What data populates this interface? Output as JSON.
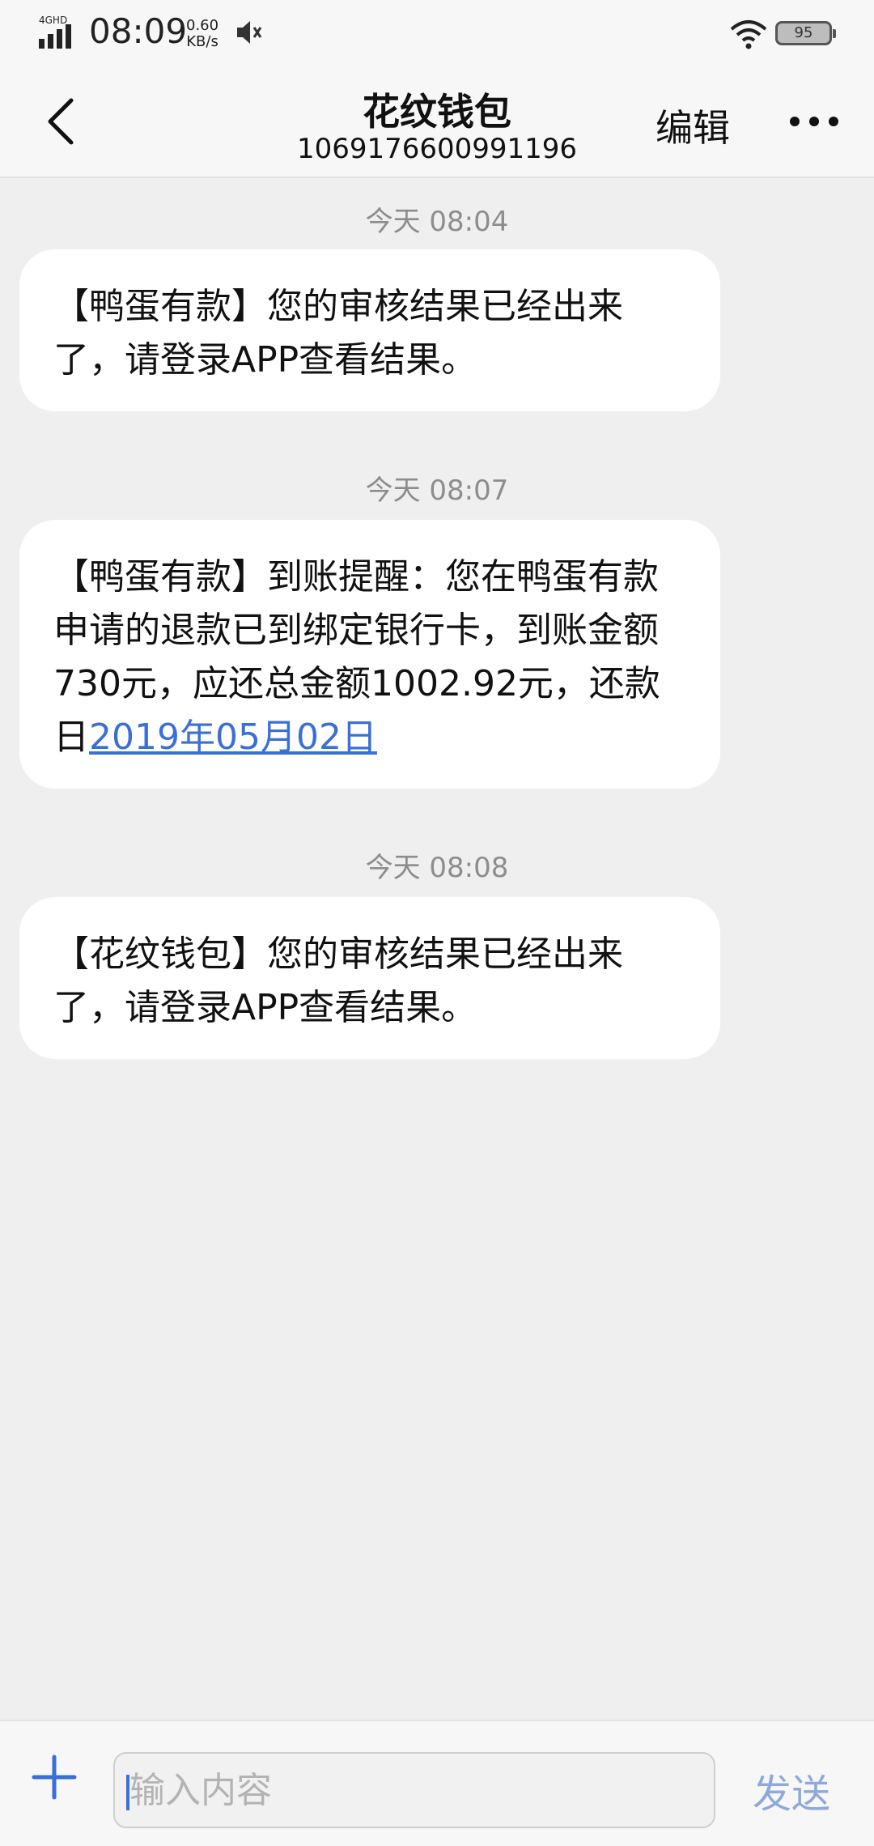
{
  "status_bar": {
    "network_type": "4GHD",
    "time": "08:09",
    "speed_value": "0.60",
    "speed_unit": "KB/s",
    "battery": "95"
  },
  "header": {
    "title": "花纹钱包",
    "number": "1069176600991196",
    "edit_label": "编辑"
  },
  "messages": [
    {
      "timestamp": "今天 08:04",
      "text": "【鸭蛋有款】您的审核结果已经出来了，请登录APP查看结果。"
    },
    {
      "timestamp": "今天 08:07",
      "text": "【鸭蛋有款】到账提醒：您在鸭蛋有款申请的退款已到绑定银行卡，到账金额730元，应还总金额1002.92元，还款日",
      "link": "2019年05月02日"
    },
    {
      "timestamp": "今天 08:08",
      "text": "【花纹钱包】您的审核结果已经出来了，请登录APP查看结果。"
    }
  ],
  "composer": {
    "placeholder": "输入内容",
    "send_label": "发送"
  },
  "colors": {
    "accent": "#3b6fd8",
    "send_disabled": "#8ea8dc",
    "background": "#efefef"
  }
}
